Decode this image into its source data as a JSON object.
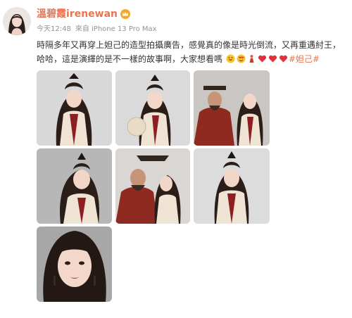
{
  "post": {
    "username": "溫碧霞irenewan",
    "timestamp": "今天12:48",
    "source": "來自 iPhone 13 Pro Max",
    "text_part1": "時隔多年又再穿上妲己的造型拍攝廣告，感覺真的像是時光倒流，又再重遇紂王，哈哈，這是演繹的是不一樣的故事啊，大家想看嗎",
    "hashtag": "#妲己#",
    "emojis": [
      "grin-emoji",
      "heart-eyes-emoji",
      "figure-emoji",
      "heart-emoji",
      "heart-emoji",
      "heart-emoji"
    ]
  },
  "photos": [
    {
      "name": "photo-1",
      "desc_icon": "portrait-image"
    },
    {
      "name": "photo-2",
      "desc_icon": "portrait-image"
    },
    {
      "name": "photo-3",
      "desc_icon": "couple-image"
    },
    {
      "name": "photo-4",
      "desc_icon": "portrait-image"
    },
    {
      "name": "photo-5",
      "desc_icon": "couple-image"
    },
    {
      "name": "photo-6",
      "desc_icon": "portrait-image"
    },
    {
      "name": "photo-7",
      "desc_icon": "closeup-portrait-image"
    }
  ],
  "colors": {
    "accent": "#eb7350",
    "meta": "#939393",
    "text": "#333333"
  }
}
